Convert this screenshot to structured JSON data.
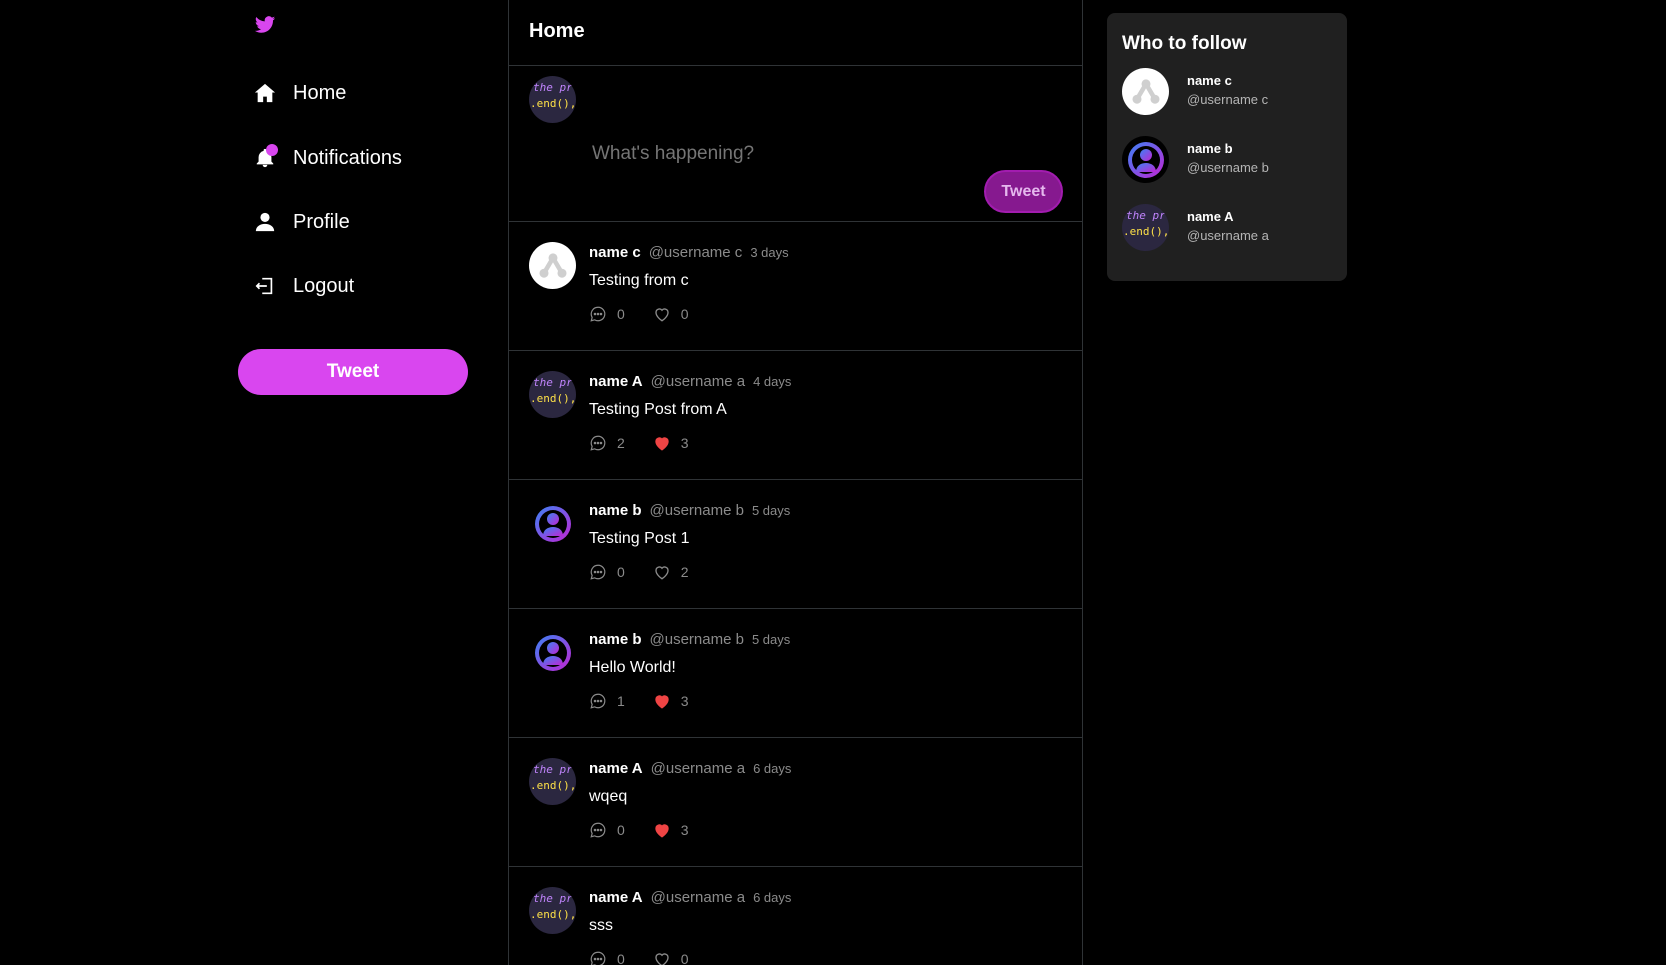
{
  "colors": {
    "accent": "#d946ef",
    "heart": "#ef4444",
    "muted": "#8b8b8b",
    "panel": "#202020"
  },
  "sidebar": {
    "logo_icon": "bird-icon",
    "items": [
      {
        "label": "Home",
        "icon": "home-icon"
      },
      {
        "label": "Notifications",
        "icon": "bell-icon"
      },
      {
        "label": "Profile",
        "icon": "user-icon"
      },
      {
        "label": "Logout",
        "icon": "logout-icon"
      }
    ],
    "tweet_label": "Tweet"
  },
  "main": {
    "title": "Home",
    "composer": {
      "placeholder": "What's happening?",
      "tweet_label": "Tweet"
    },
    "avatar_code": {
      "line1": "the pr",
      "line2": ".end(),"
    },
    "posts": [
      {
        "avatar": "c",
        "name": "name c",
        "username": "@username c",
        "time": "3 days",
        "text": "Testing from c",
        "comments": "0",
        "likes": "0",
        "liked": false
      },
      {
        "avatar": "a",
        "name": "name A",
        "username": "@username a",
        "time": "4 days",
        "text": "Testing Post from A",
        "comments": "2",
        "likes": "3",
        "liked": true
      },
      {
        "avatar": "b",
        "name": "name b",
        "username": "@username b",
        "time": "5 days",
        "text": "Testing Post 1",
        "comments": "0",
        "likes": "2",
        "liked": false
      },
      {
        "avatar": "b",
        "name": "name b",
        "username": "@username b",
        "time": "5 days",
        "text": "Hello World!",
        "comments": "1",
        "likes": "3",
        "liked": true
      },
      {
        "avatar": "a",
        "name": "name A",
        "username": "@username a",
        "time": "6 days",
        "text": "wqeq",
        "comments": "0",
        "likes": "3",
        "liked": true
      },
      {
        "avatar": "a",
        "name": "name A",
        "username": "@username a",
        "time": "6 days",
        "text": "sss",
        "comments": "0",
        "likes": "0",
        "liked": false
      }
    ]
  },
  "who_to_follow": {
    "title": "Who to follow",
    "items": [
      {
        "avatar": "c",
        "name": "name c",
        "username": "@username c"
      },
      {
        "avatar": "b",
        "name": "name b",
        "username": "@username b"
      },
      {
        "avatar": "a",
        "name": "name A",
        "username": "@username a"
      }
    ]
  }
}
